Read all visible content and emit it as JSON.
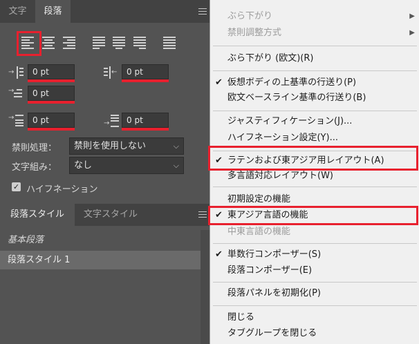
{
  "panel": {
    "tabs": [
      "文字",
      "段落"
    ],
    "menu_icon": "hamburger-icon",
    "alignment_icons": [
      "align-left-icon",
      "align-center-icon",
      "align-right-icon",
      "justify-last-left-icon",
      "justify-last-center-icon",
      "justify-last-right-icon",
      "justify-all-icon"
    ],
    "fields": {
      "left_indent": "0 pt",
      "right_indent": "0 pt",
      "first_line_indent": "0 pt",
      "space_before": "0 pt",
      "space_after": "0 pt"
    },
    "kinsoku_label": "禁則処理：",
    "kinsoku_value": "禁則を使用しない",
    "mojikumi_label": "文字組み：",
    "mojikumi_value": "なし",
    "hyphenation_label": "ハイフネーション",
    "hyphenation_checked": true
  },
  "styles_panel": {
    "tabs": [
      "段落スタイル",
      "文字スタイル"
    ],
    "items": [
      "基本段落",
      "段落スタイル 1"
    ]
  },
  "menu": {
    "items": [
      {
        "label": "ぶら下がり",
        "disabled": true,
        "submenu": true
      },
      {
        "label": "禁則調整方式",
        "disabled": true,
        "submenu": true
      },
      {
        "label": "ぶら下がり (欧文)(R)"
      },
      {
        "label": "仮想ボディの上基準の行送り(P)",
        "checked": true
      },
      {
        "label": "欧文ベースライン基準の行送り(B)"
      },
      {
        "label": "ジャスティフィケーション(J)..."
      },
      {
        "label": "ハイフネーション設定(Y)..."
      },
      {
        "label": "ラテンおよび東アジア用レイアウト(A)",
        "checked": true
      },
      {
        "label": "多言語対応レイアウト(W)"
      },
      {
        "label": "初期設定の機能"
      },
      {
        "label": "東アジア言語の機能",
        "checked": true
      },
      {
        "label": "中東言語の機能",
        "disabled": true
      },
      {
        "label": "単数行コンポーザー(S)",
        "checked": true
      },
      {
        "label": "段落コンポーザー(E)"
      },
      {
        "label": "段落パネルを初期化(P)"
      },
      {
        "label": "閉じる"
      },
      {
        "label": "タブグループを閉じる"
      }
    ]
  },
  "colors": {
    "highlight": "#e8202e",
    "panel_bg": "#535353",
    "menu_bg": "#f0f0f0"
  }
}
